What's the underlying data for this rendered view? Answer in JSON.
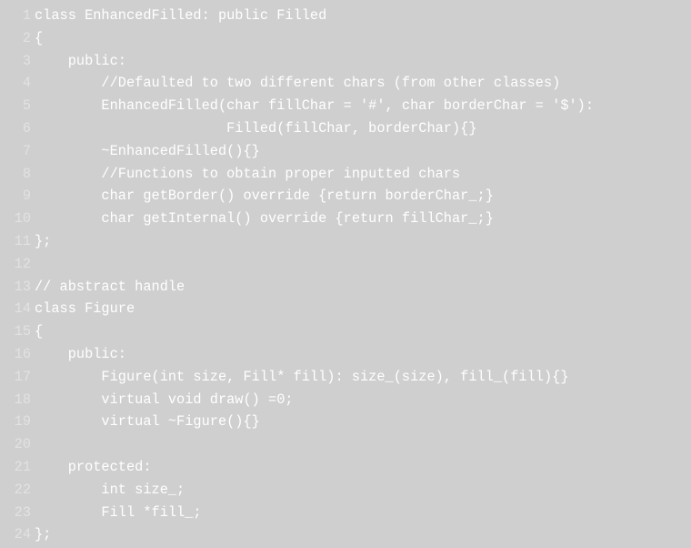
{
  "editor": {
    "lines": [
      {
        "n": "1",
        "text": "class EnhancedFilled: public Filled"
      },
      {
        "n": "2",
        "text": "{"
      },
      {
        "n": "3",
        "text": "    public:"
      },
      {
        "n": "4",
        "text": "        //Defaulted to two different chars (from other classes)"
      },
      {
        "n": "5",
        "text": "        EnhancedFilled(char fillChar = '#', char borderChar = '$'):"
      },
      {
        "n": "6",
        "text": "                       Filled(fillChar, borderChar){}"
      },
      {
        "n": "7",
        "text": "        ~EnhancedFilled(){}"
      },
      {
        "n": "8",
        "text": "        //Functions to obtain proper inputted chars"
      },
      {
        "n": "9",
        "text": "        char getBorder() override {return borderChar_;}"
      },
      {
        "n": "10",
        "text": "        char getInternal() override {return fillChar_;}"
      },
      {
        "n": "11",
        "text": "};"
      },
      {
        "n": "12",
        "text": ""
      },
      {
        "n": "13",
        "text": "// abstract handle"
      },
      {
        "n": "14",
        "text": "class Figure"
      },
      {
        "n": "15",
        "text": "{"
      },
      {
        "n": "16",
        "text": "    public:"
      },
      {
        "n": "17",
        "text": "        Figure(int size, Fill* fill): size_(size), fill_(fill){}"
      },
      {
        "n": "18",
        "text": "        virtual void draw() =0;"
      },
      {
        "n": "19",
        "text": "        virtual ~Figure(){}"
      },
      {
        "n": "20",
        "text": ""
      },
      {
        "n": "21",
        "text": "    protected:"
      },
      {
        "n": "22",
        "text": "        int size_;"
      },
      {
        "n": "23",
        "text": "        Fill *fill_;"
      },
      {
        "n": "24",
        "text": "};"
      }
    ]
  }
}
